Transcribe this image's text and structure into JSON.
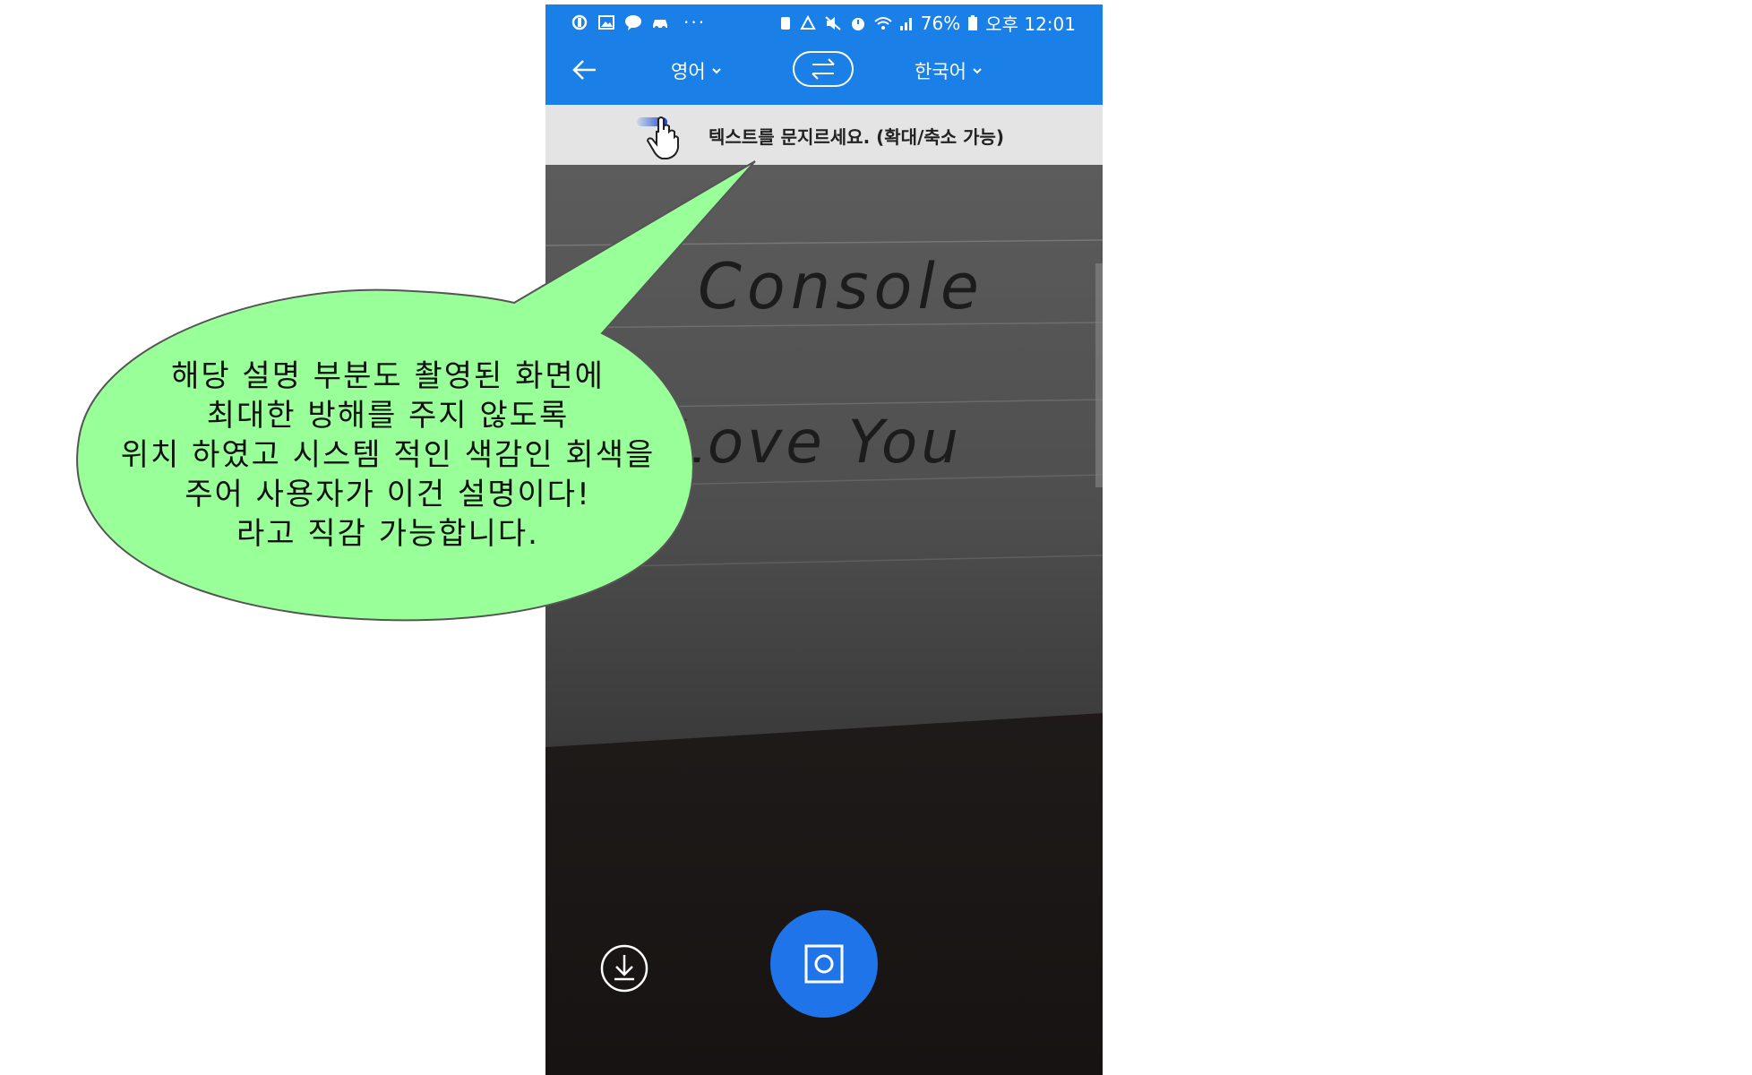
{
  "statusbar": {
    "battery": "76%",
    "time": "오후 12:01",
    "more_dots": "···",
    "left_icons": [
      "sync-icon",
      "gallery-icon",
      "chat-icon",
      "car-icon"
    ],
    "right_icons": [
      "sim-icon",
      "recycle-icon",
      "mute-icon",
      "alarm-icon",
      "wifi-icon",
      "signal-icon",
      "battery-icon"
    ]
  },
  "appbar": {
    "source_language": "영어",
    "target_language": "한국어"
  },
  "hint": {
    "text": "텍스트를 문지르세요. (확대/축소 가능)"
  },
  "camera": {
    "handwriting": [
      "Console",
      "Love You"
    ]
  },
  "annotation": {
    "lines": [
      "해당 설명 부분도 촬영된 화면에",
      "최대한 방해를 주지 않도록",
      "위치 하였고 시스템 적인 색감인 회색을",
      "주어 사용자가 이건 설명이다!",
      "라고 직감 가능합니다."
    ],
    "fill": "#99ff99",
    "stroke": "#555555"
  },
  "colors": {
    "accent": "#1a7fe6",
    "hint_bg": "#e4e4e4",
    "shutter": "#1e74e8"
  }
}
